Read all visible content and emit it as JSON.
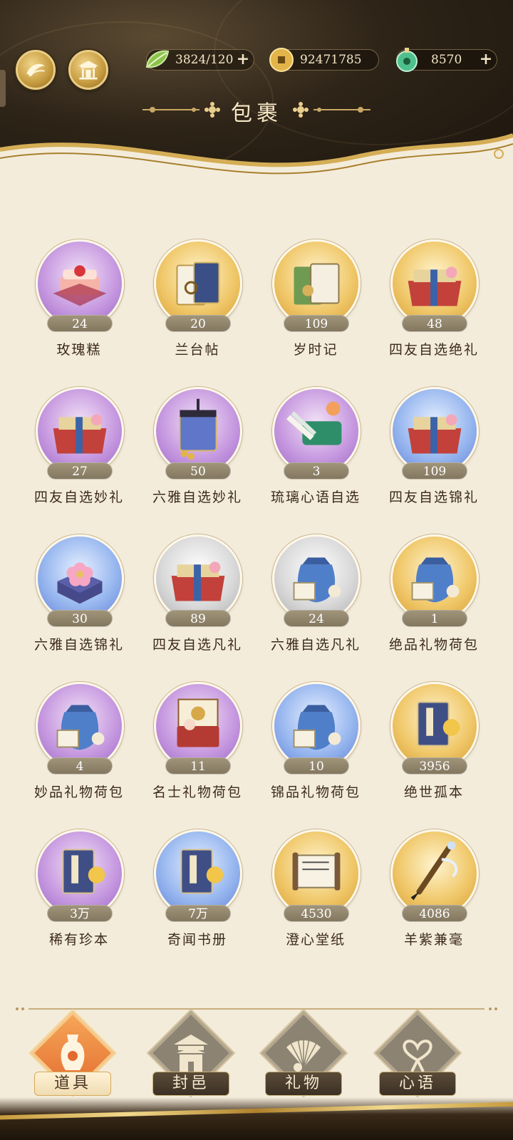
{
  "header": {
    "title": "包裹",
    "left_buttons": [
      "leaf-emblem-icon",
      "pavilion-icon"
    ],
    "resources": [
      {
        "icon": "green-leaf-icon",
        "value": "3824/120",
        "has_plus": true
      },
      {
        "icon": "copper-coin-icon",
        "value": "92471785",
        "has_plus": false
      },
      {
        "icon": "jade-pendant-icon",
        "value": "8570",
        "has_plus": true
      }
    ]
  },
  "items": [
    {
      "name": "玫瑰糕",
      "count": "24",
      "bg": "purple",
      "icon": "rose-cake-icon"
    },
    {
      "name": "兰台帖",
      "count": "20",
      "bg": "gold",
      "icon": "invitation-card-icon"
    },
    {
      "name": "岁时记",
      "count": "109",
      "bg": "gold",
      "icon": "calendar-book-icon"
    },
    {
      "name": "四友自选绝礼",
      "count": "48",
      "bg": "gold",
      "icon": "gift-box-icon"
    },
    {
      "name": "四友自选妙礼",
      "count": "27",
      "bg": "purple",
      "icon": "gift-box-icon"
    },
    {
      "name": "六雅自选妙礼",
      "count": "50",
      "bg": "purple",
      "icon": "lantern-box-icon"
    },
    {
      "name": "琉璃心语自选",
      "count": "3",
      "bg": "purple",
      "icon": "bamboo-case-icon"
    },
    {
      "name": "四友自选锦礼",
      "count": "109",
      "bg": "blue",
      "icon": "gift-box-icon"
    },
    {
      "name": "六雅自选锦礼",
      "count": "30",
      "bg": "blue",
      "icon": "flower-box-icon"
    },
    {
      "name": "四友自选凡礼",
      "count": "89",
      "bg": "grey",
      "icon": "gift-box-icon"
    },
    {
      "name": "六雅自选凡礼",
      "count": "24",
      "bg": "grey",
      "icon": "pouch-icon"
    },
    {
      "name": "绝品礼物荷包",
      "count": "1",
      "bg": "gold",
      "icon": "pouch-icon"
    },
    {
      "name": "妙品礼物荷包",
      "count": "4",
      "bg": "purple",
      "icon": "pouch-icon"
    },
    {
      "name": "名士礼物荷包",
      "count": "11",
      "bg": "purple",
      "icon": "scroll-box-icon"
    },
    {
      "name": "锦品礼物荷包",
      "count": "10",
      "bg": "blue",
      "icon": "pouch-icon"
    },
    {
      "name": "绝世孤本",
      "count": "3956",
      "bg": "gold",
      "icon": "book-icon"
    },
    {
      "name": "稀有珍本",
      "count": "3万",
      "bg": "purple",
      "icon": "book-icon"
    },
    {
      "name": "奇闻书册",
      "count": "7万",
      "bg": "blue",
      "icon": "book-icon"
    },
    {
      "name": "澄心堂纸",
      "count": "4530",
      "bg": "gold",
      "icon": "paper-scroll-icon"
    },
    {
      "name": "羊紫兼毫",
      "count": "4086",
      "bg": "gold",
      "icon": "brush-icon"
    }
  ],
  "tabs": [
    {
      "label": "道具",
      "icon": "vase-icon",
      "active": true
    },
    {
      "label": "封邑",
      "icon": "temple-icon",
      "active": false
    },
    {
      "label": "礼物",
      "icon": "fan-icon",
      "active": false
    },
    {
      "label": "心语",
      "icon": "heart-knot-icon",
      "active": false
    }
  ]
}
